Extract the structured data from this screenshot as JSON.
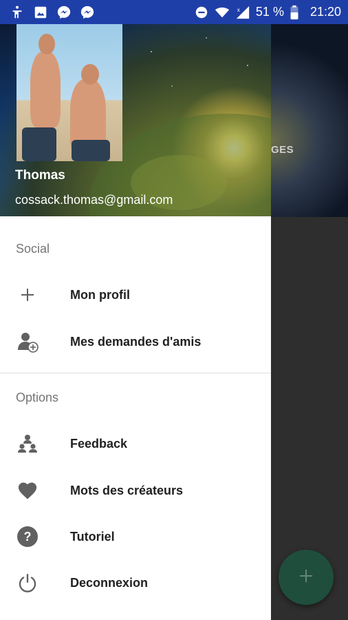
{
  "status_bar": {
    "battery_percent": "51 %",
    "time": "21:20",
    "left_icons": [
      "accessibility-icon",
      "image-icon",
      "messenger-icon",
      "messenger-icon"
    ],
    "right_icons": [
      "do-not-disturb-icon",
      "wifi-icon",
      "signal-icon",
      "battery-icon"
    ]
  },
  "background_app": {
    "tab_fragment": "GES"
  },
  "drawer": {
    "header": {
      "name": "Thomas",
      "email": "cossack.thomas@gmail.com"
    },
    "sections": [
      {
        "title": "Social",
        "items": [
          {
            "label": "Mon profil",
            "icon": "plus-icon"
          },
          {
            "label": "Mes demandes d'amis",
            "icon": "friend-request-icon"
          }
        ]
      },
      {
        "title": "Options",
        "items": [
          {
            "label": "Feedback",
            "icon": "feedback-icon"
          },
          {
            "label": "Mots des créateurs",
            "icon": "heart-icon"
          },
          {
            "label": "Tutoriel",
            "icon": "help-icon"
          },
          {
            "label": "Deconnexion",
            "icon": "power-icon"
          }
        ]
      }
    ]
  },
  "colors": {
    "status_bar": "#1f3fa8",
    "fab": "#1f4e3c",
    "icon_gray": "#616161",
    "section_gray": "#757575"
  }
}
